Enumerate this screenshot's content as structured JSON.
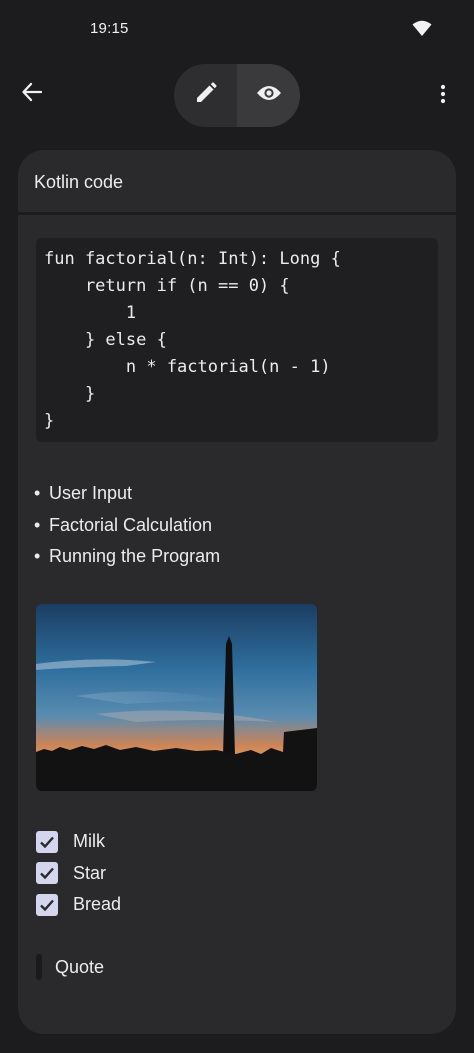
{
  "status_bar": {
    "time": "19:15",
    "wifi_icon": "wifi-icon"
  },
  "toolbar": {
    "back_icon": "arrow-back-icon",
    "edit_icon": "pencil-icon",
    "preview_icon": "eye-icon",
    "active_mode": "preview",
    "more_icon": "more-vert-icon"
  },
  "note": {
    "title": "Kotlin code",
    "code_lines": [
      "fun factorial(n: Int): Long {",
      "    return if (n == 0) {",
      "        1",
      "    } else {",
      "        n * factorial(n - 1)",
      "    }",
      "}"
    ],
    "bullets": [
      "User Input",
      "Factorial Calculation",
      "Running the Program"
    ],
    "image_description_icon": "photo-obelisk-sunset",
    "checklist": [
      {
        "label": "Milk",
        "checked": true
      },
      {
        "label": "Star",
        "checked": true
      },
      {
        "label": "Bread",
        "checked": true
      }
    ],
    "quote": "Quote"
  },
  "colors": {
    "background": "#1c1c1e",
    "card": "#2a2a2c",
    "code_bg": "#1f1f21",
    "checkbox": "#d3d6ee",
    "text": "#ececec"
  }
}
